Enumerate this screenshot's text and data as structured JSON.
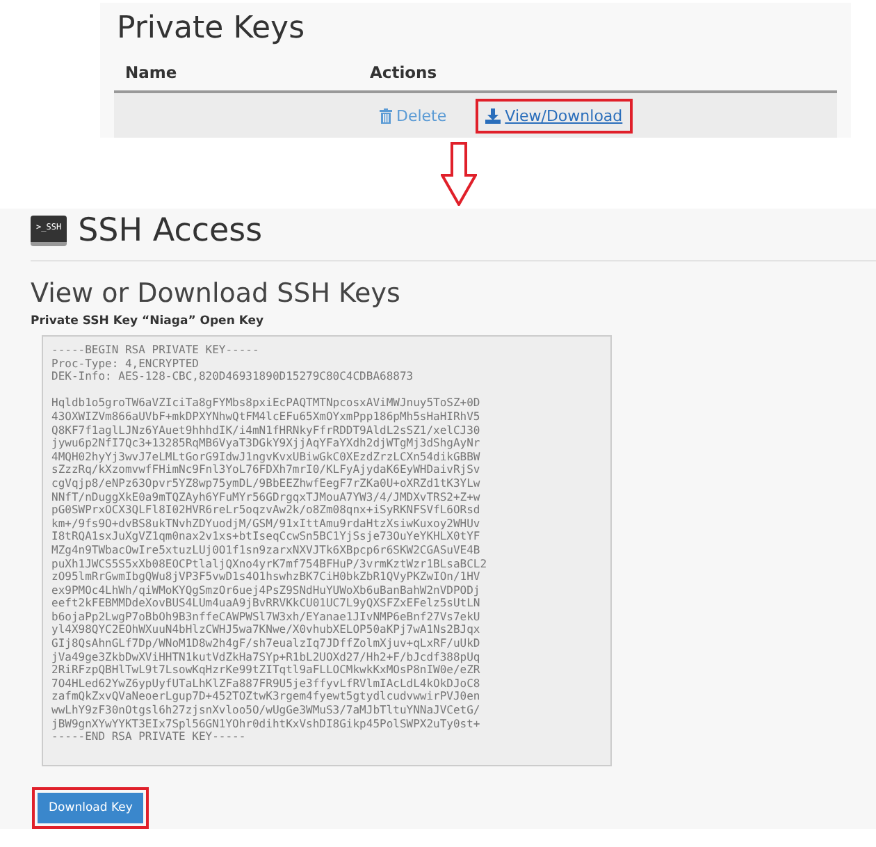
{
  "private_keys": {
    "title": "Private Keys",
    "columns": [
      "Name",
      "Actions"
    ],
    "rows": [
      {
        "actions": [
          {
            "kind": "delete",
            "label": "Delete",
            "highlighted": false
          },
          {
            "kind": "download",
            "label": "View/Download",
            "highlighted": true
          }
        ]
      }
    ]
  },
  "ssh_access": {
    "icon_label": ">_SSH",
    "title": "SSH Access",
    "heading": "View or Download SSH Keys",
    "key_label": "Private SSH Key “Niaga” Open Key",
    "key_header_lines": [
      "-----BEGIN RSA PRIVATE KEY-----",
      "Proc-Type: 4,ENCRYPTED",
      "DEK-Info: AES-128-CBC,820D46931890D15279C80C4CDBA68873"
    ],
    "key_body_lines": [
      "Hqldb1o5groTW6aVZIciTa8gFYMbs8pxiEcPAQTMTNpcosxAViMWJnuy5ToSZ+0D",
      "43OXWIZVm866aUVbF+mkDPXYNhwQtFM4lcEFu65XmOYxmPpp186pMh5sHaHIRhV5",
      "Q8KF7f1aglLJNz6YAuet9hhhdIK/i4mN1fHRNkyFfrRDDT9AldL2sSZ1/xelCJ30",
      "jywu6p2NfI7Qc3+13285RqMB6VyaT3DGkY9XjjAqYFaYXdh2djWTgMj3dShgAyNr",
      "4MQH02hyYj3wvJ7eLMLtGorG9IdwJ1ngvKvxUBiwGkC0XEzdZrzLCXn54dikGBBW",
      "sZzzRq/kXzomvwfFHimNc9Fnl3YoL76FDXh7mrI0/KLFyAjydaK6EyWHDaivRjSv",
      "cgVqjp8/eNPz63Opvr5YZ8wp75ymDL/9BbEEZhwfEegF7rZKa0U+oXRZd1tK3YLw",
      "NNfT/nDuggXkE0a9mTQZAyh6YFuMYr56GDrgqxTJMouA7YW3/4/JMDXvTRS2+Z+w",
      "pG0SWPrxOCX3QLFl8I02HVR6reLr5oqzvAw2k/o8Zm08qnx+iSyRKNFSVfL6ORsd",
      "km+/9fs9O+dvBS8ukTNvhZDYuodjM/GSM/91xIttAmu9rdaHtzXsiwKuxoy2WHUv",
      "I8tRQA1sxJuXgVZ1qm0nax2v1xs+btIseqCcwSn5BC1YjSsje73OuYeYKHLX0tYF",
      "MZg4n9TWbacOwIre5xtuzLUj0O1f1sn9zarxNXVJTk6XBpcp6r6SKW2CGASuVE4B",
      "puXh1JWCS5S5xXb08EOCPtlaljQXno4yrK7mf754BFHuP/3vrmKztWzr1BLsaBCL2",
      "zO95lmRrGwmIbgQWu8jVP3F5vwD1s4O1hswhzBK7CiH0bkZbR1QVyPKZwIOn/1HV",
      "ex9PMOc4LhWh/qiWMoKYQgSmzOr6uej4PsZ9SNdHuYUWoXb6uBanBahW2nVDPODj",
      "eeft2kFEBMMDdeXovBUS4LUm4uaA9jBvRRVKkCU01UC7L9yQXSFZxEFelz5sUtLN",
      "b6ojaPp2LwgP7oBbOh9B3nffeCAWPWSl7W3xh/EYanae1JIvNMP6eBnf27Vs7ekU",
      "yl4X98QYC2EOhWXuuN4bHlzCWHJ5wa7KNwe/X0vhubXELOP50aKPj7wA1Ns2BJqx",
      "GIj8QsAhnGLf7Dp/WNoM1D8w2h4gF/sh7eualzIq7JDffZolmXjuv+qLxRF/uUkD",
      "jVa49ge3ZkbDwXViHHTN1kutVdZkHa7SYp+R1bL2UOXd27/Hh2+F/bJcdf388pUq",
      "2RiRFzpQBHlTwL9t7LsowKqHzrKe99tZITqtl9aFLLOCMkwkKxMOsP8nIW0e/eZR",
      "7O4HLed62YwZ6ypUyfUTaLhKlZFa887FR9U5je3ffyvLfRVlmIAcLdL4kOkDJoC8",
      "zafmQkZxvQVaNeoerLgup7D+452TOZtwK3rgem4fyewt5gtydlcudvwwirPVJ0en",
      "wwLhY9zF30nOtgsl6h27zjsnXvloo5O/wUgGe3WMuS3/7aMJbTltuYNNaJVCetG/",
      "jBW9gnXYwYYKT3EIx7Spl56GN1YOhr0dihtKxVshDI8Gikp45PolSWPX2uTy0st+",
      "-----END RSA PRIVATE KEY-----"
    ],
    "button": {
      "label": "Download Key",
      "highlighted": true
    }
  }
}
